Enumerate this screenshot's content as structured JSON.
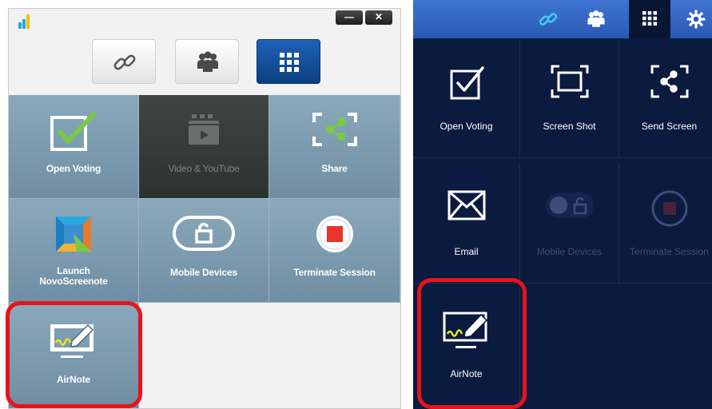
{
  "left_app": {
    "window_buttons": {
      "minimize": "—",
      "close": "✕"
    },
    "tabs": [
      {
        "icon": "link-icon"
      },
      {
        "icon": "people-icon"
      },
      {
        "icon": "grid-icon",
        "active": true
      }
    ],
    "tiles": [
      {
        "label": "Open Voting",
        "icon": "checkbox-icon",
        "enabled": true
      },
      {
        "label": "Video & YouTube",
        "icon": "video-clapper-icon",
        "enabled": false
      },
      {
        "label": "Share",
        "icon": "share-screen-icon",
        "enabled": true
      },
      {
        "label": "Launch\nNovoScreenote",
        "icon": "novoscreenote-icon",
        "enabled": true
      },
      {
        "label": "Mobile Devices",
        "icon": "lock-icon",
        "enabled": true
      },
      {
        "label": "Terminate Session",
        "icon": "stop-icon",
        "enabled": true
      },
      {
        "label": "AirNote",
        "icon": "airnote-icon",
        "enabled": true,
        "highlighted": true
      }
    ]
  },
  "right_app": {
    "tabs": [
      {
        "icon": "link-icon"
      },
      {
        "icon": "people-icon"
      },
      {
        "icon": "grid-icon",
        "active": true
      },
      {
        "icon": "gear-icon"
      }
    ],
    "tiles": [
      {
        "label": "Open Voting",
        "icon": "checkbox-icon",
        "enabled": true
      },
      {
        "label": "Screen Shot",
        "icon": "screenshot-icon",
        "enabled": true
      },
      {
        "label": "Send Screen",
        "icon": "share-screen-icon",
        "enabled": true
      },
      {
        "label": "Email",
        "icon": "envelope-icon",
        "enabled": true
      },
      {
        "label": "Mobile Devices",
        "icon": "toggle-lock-icon",
        "enabled": false
      },
      {
        "label": "Terminate Session",
        "icon": "stop-icon",
        "enabled": false
      },
      {
        "label": "AirNote",
        "icon": "airnote-icon",
        "enabled": true,
        "highlighted": true
      }
    ]
  },
  "colors": {
    "highlight": "#e8121b",
    "left_tile": "#7e9db2",
    "left_tile_disabled": "#343c3a",
    "right_bg": "#0b1a3f",
    "right_topbar": "#3466c4",
    "check_green": "#7ac943"
  }
}
